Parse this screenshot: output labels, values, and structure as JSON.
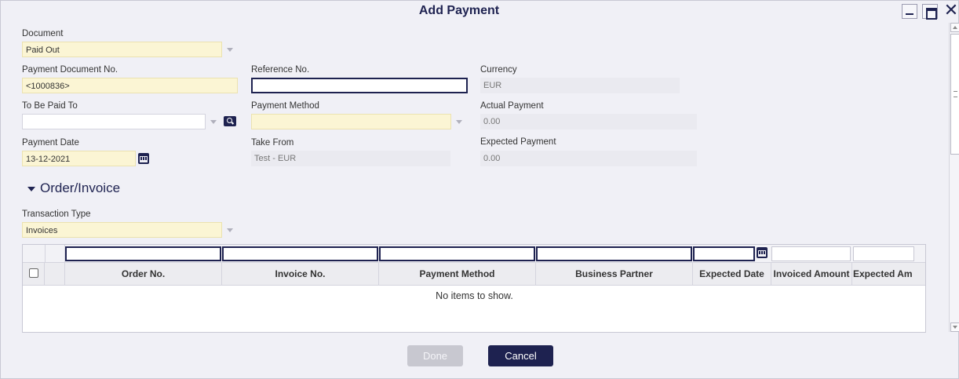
{
  "dialog": {
    "title": "Add Payment"
  },
  "fields": {
    "document": {
      "label": "Document",
      "value": "Paid Out"
    },
    "payment_document_no": {
      "label": "Payment Document No.",
      "value": "<1000836>"
    },
    "reference_no": {
      "label": "Reference No.",
      "value": ""
    },
    "currency": {
      "label": "Currency",
      "value": "EUR"
    },
    "to_be_paid_to": {
      "label": "To Be Paid To",
      "value": ""
    },
    "payment_method": {
      "label": "Payment Method",
      "value": ""
    },
    "actual_payment": {
      "label": "Actual Payment",
      "value": "0.00"
    },
    "payment_date": {
      "label": "Payment Date",
      "value": "13-12-2021"
    },
    "take_from": {
      "label": "Take From",
      "value": "Test - EUR"
    },
    "expected_payment": {
      "label": "Expected Payment",
      "value": "0.00"
    }
  },
  "section": {
    "title": "Order/Invoice"
  },
  "transaction_type": {
    "label": "Transaction Type",
    "value": "Invoices"
  },
  "grid": {
    "columns": [
      "Order No.",
      "Invoice No.",
      "Payment Method",
      "Business Partner",
      "Expected Date",
      "Invoiced Amount",
      "Expected Am"
    ],
    "empty_message": "No items to show."
  },
  "buttons": {
    "done": "Done",
    "cancel": "Cancel"
  },
  "icons": {
    "minimize": "minimize-icon",
    "maximize": "maximize-icon",
    "close": "close-icon",
    "search": "search-icon",
    "calendar": "calendar-icon",
    "dropdown": "chevron-down-icon"
  },
  "colors": {
    "accent": "#1e2250",
    "required_bg": "#fbf5d4",
    "readonly_bg": "#eaeaf0",
    "dialog_bg": "#f0f0f6"
  }
}
